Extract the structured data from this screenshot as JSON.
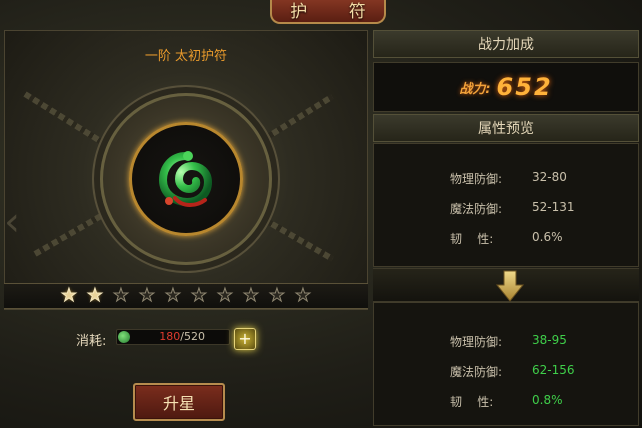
{
  "window": {
    "title": "护 符"
  },
  "item": {
    "name": "一阶 太初护符",
    "star_count": 10,
    "stars_lit": 2
  },
  "cost": {
    "label": "消耗:",
    "current": "180",
    "total": "/520",
    "plus_label": "+"
  },
  "upgrade_button": {
    "label": "升星"
  },
  "power_panel": {
    "header": "战力加成",
    "label": "战力:",
    "value": "652"
  },
  "preview_panel": {
    "header": "属性预览"
  },
  "current_stats": [
    {
      "name": "物理防御:",
      "value": "32-80"
    },
    {
      "name": "魔法防御:",
      "value": "52-131"
    },
    {
      "name": "韧    性:",
      "value": "0.6%"
    }
  ],
  "next_stats": [
    {
      "name": "物理防御:",
      "value": "38-95"
    },
    {
      "name": "魔法防御:",
      "value": "62-156"
    },
    {
      "name": "韧    性:",
      "value": "0.8%"
    }
  ],
  "colors": {
    "accent_orange": "#e89a2c",
    "stat_green": "#3fcf4a",
    "cost_red": "#e03b2f",
    "gold_border": "#b58a4a"
  },
  "icons": [
    "jade-dragon-amulet-icon",
    "star-icon",
    "plus-icon",
    "down-arrow-icon",
    "left-arrow-icon",
    "right-arrow-icon",
    "cost-gem-icon"
  ]
}
